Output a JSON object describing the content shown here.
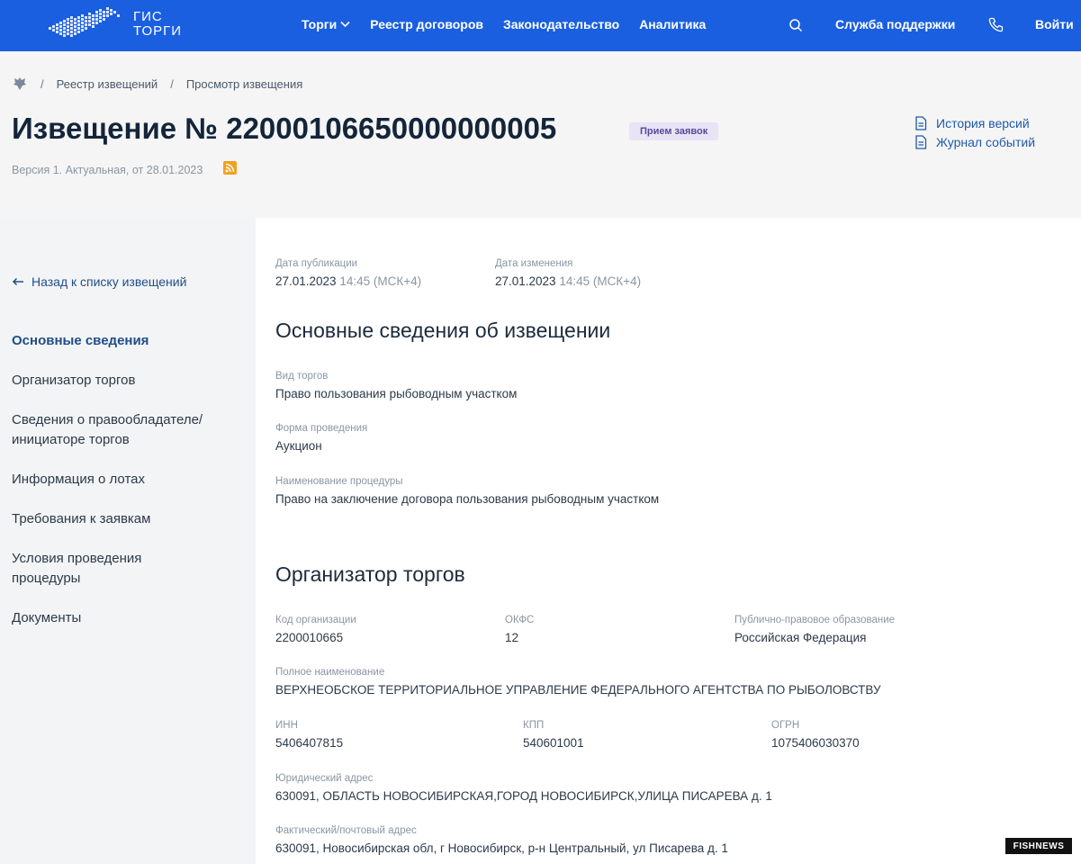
{
  "topbar": {
    "logo_line1": "ГИС",
    "logo_line2": "ТОРГИ",
    "nav": [
      {
        "label": "Торги"
      },
      {
        "label": "Реестр договоров"
      },
      {
        "label": "Законодательство"
      },
      {
        "label": "Аналитика"
      }
    ],
    "support_label": "Служба поддержки",
    "login_label": "Войти"
  },
  "breadcrumb": {
    "items": [
      "Реестр извещений",
      "Просмотр извещения"
    ],
    "separator": "/"
  },
  "header": {
    "title": "Извещение № 22000106650000000005",
    "status": "Прием заявок",
    "version": "Версия 1. Актуальная, от 28.01.2023",
    "links": [
      "История версий",
      "Журнал событий"
    ]
  },
  "sidebar": {
    "back_label": "Назад к списку извещений",
    "menu": [
      "Основные сведения",
      "Организатор торгов",
      "Сведения о правообладателе/ инициаторе торгов",
      "Информация о лотах",
      "Требования к заявкам",
      "Условия проведения процедуры",
      "Документы"
    ]
  },
  "dates": {
    "published_label": "Дата публикации",
    "published_date": "27.01.2023",
    "published_time": "14:45 (МСК+4)",
    "changed_label": "Дата изменения",
    "changed_date": "27.01.2023",
    "changed_time": "14:45 (МСК+4)"
  },
  "basic": {
    "title": "Основные сведения об извещении",
    "fields": [
      {
        "label": "Вид торгов",
        "value": "Право пользования рыбоводным участком"
      },
      {
        "label": "Форма проведения",
        "value": "Аукцион"
      },
      {
        "label": "Наименование процедуры",
        "value": "Право на заключение договора пользования рыбоводным участком"
      }
    ]
  },
  "organizer": {
    "title": "Организатор торгов",
    "org_code_label": "Код организации",
    "org_code": "2200010665",
    "okfs_label": "ОКФС",
    "okfs": "12",
    "ppo_label": "Публично-правовое образование",
    "ppo": "Российская Федерация",
    "fullname_label": "Полное наименование",
    "fullname": "ВЕРХНЕОБСКОЕ ТЕРРИТОРИАЛЬНОЕ УПРАВЛЕНИЕ ФЕДЕРАЛЬНОГО АГЕНТСТВА ПО РЫБОЛОВСТВУ",
    "inn_label": "ИНН",
    "inn": "5406407815",
    "kpp_label": "КПП",
    "kpp": "540601001",
    "ogrn_label": "ОГРН",
    "ogrn": "1075406030370",
    "legal_address_label": "Юридический адрес",
    "legal_address": "630091, ОБЛАСТЬ НОВОСИБИРСКАЯ,ГОРОД НОВОСИБИРСК,УЛИЦА ПИСАРЕВА д. 1",
    "postal_address_label": "Фактический/почтовый адрес",
    "postal_address": "630091, Новосибирская обл, г Новосибирск, р-н Центральный, ул Писарева д. 1"
  },
  "watermark": "FISHNEWS",
  "colors": {
    "topbar": "#1a5fe0",
    "accent": "#1f4e88",
    "badge_bg": "#e8e4f6",
    "rss": "#f0a020"
  }
}
